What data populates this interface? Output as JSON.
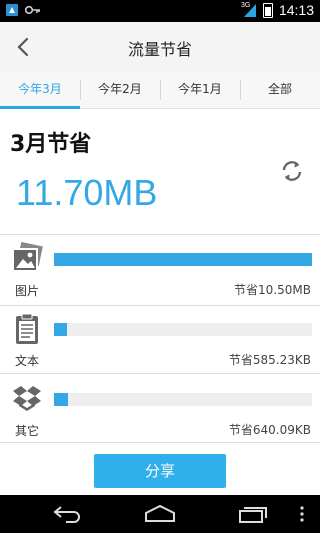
{
  "status_bar": {
    "time": "14:13",
    "network": "3G",
    "icons": [
      "notification-app-icon",
      "key-icon",
      "signal-icon",
      "battery-icon"
    ]
  },
  "header": {
    "title": "流量节省",
    "back_icon": "chevron-left-icon"
  },
  "tabs": [
    {
      "label": "今年3月",
      "active": true
    },
    {
      "label": "今年2月",
      "active": false
    },
    {
      "label": "今年1月",
      "active": false
    },
    {
      "label": "全部",
      "active": false
    }
  ],
  "summary": {
    "title": "3月节省",
    "amount": "11.70MB",
    "refresh_icon": "refresh-icon"
  },
  "categories": [
    {
      "icon": "image-icon",
      "label": "图片",
      "value": "节省10.50MB",
      "fraction": 1.0
    },
    {
      "icon": "document-icon",
      "label": "文本",
      "value": "节省585.23KB",
      "fraction": 0.05
    },
    {
      "icon": "box-icon",
      "label": "其它",
      "value": "节省640.09KB",
      "fraction": 0.055
    }
  ],
  "share_button": {
    "label": "分享"
  },
  "nav_bar": {
    "icons": [
      "back-nav-icon",
      "home-nav-icon",
      "recent-apps-icon",
      "overflow-menu-icon"
    ]
  },
  "colors": {
    "accent": "#34a8e4",
    "button": "#2fb0ea",
    "text_dark": "#111111"
  }
}
